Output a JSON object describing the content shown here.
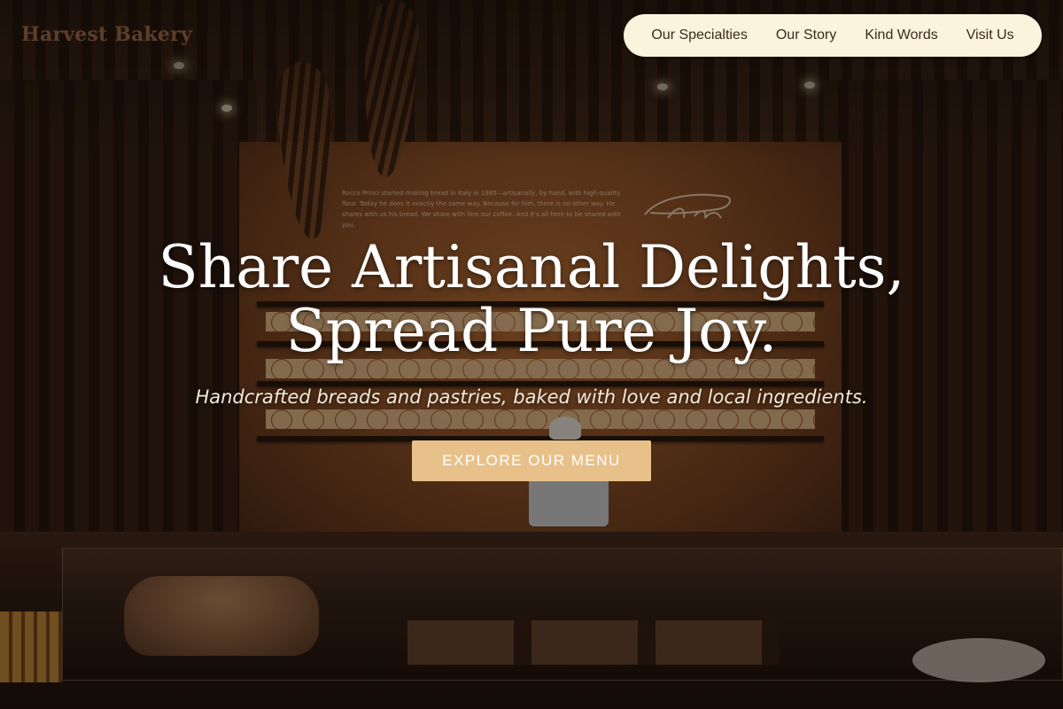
{
  "brand": {
    "name": "Harvest Bakery"
  },
  "nav": {
    "items": [
      {
        "label": "Our Specialties"
      },
      {
        "label": "Our Story"
      },
      {
        "label": "Kind Words"
      },
      {
        "label": "Visit Us"
      }
    ]
  },
  "hero": {
    "title_line1": "Share Artisanal Delights,",
    "title_line2": "Spread Pure Joy.",
    "subtitle": "Handcrafted breads and pastries, baked with love and local ingredients.",
    "cta_label": "EXPLORE OUR MENU"
  },
  "background": {
    "wall_text": "Rocco Princi started making bread in Italy in 1985—artisanally, by hand, with high-quality flour. Today he does it exactly the same way. Because for him, there is no other way. He shares with us his bread. We share with him our coffee. And it's all here to be shared with you."
  },
  "colors": {
    "nav_background": "#fbf3dc",
    "cta_background": "#e8c18a",
    "brand_text": "#5d3e2a",
    "hero_text": "#ffffff"
  }
}
